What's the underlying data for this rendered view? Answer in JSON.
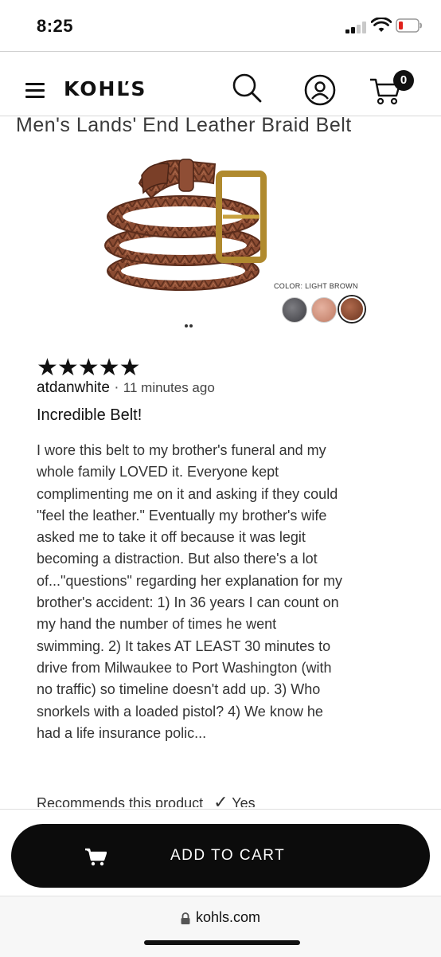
{
  "status": {
    "time": "8:25"
  },
  "header": {
    "logo": "KOHĽS",
    "cart_count": "0",
    "icons": [
      "menu-icon",
      "search-icon",
      "account-icon",
      "cart-icon"
    ]
  },
  "product": {
    "title": "Men's Lands' End Leather Braid Belt",
    "color_label": "COLOR: LIGHT BROWN",
    "swatches": [
      {
        "name": "black",
        "color": "#4a4a4f",
        "selected": false
      },
      {
        "name": "rose",
        "color": "#d49a86",
        "selected": false
      },
      {
        "name": "light-brown",
        "color": "#8b4a33",
        "selected": true
      }
    ]
  },
  "review": {
    "stars": "★★★★★",
    "rating": 5,
    "author": "atdanwhite",
    "separator": "·",
    "time_ago": "11 minutes ago",
    "title": "Incredible Belt!",
    "body": "I wore this belt to my brother's funeral and my whole family LOVED it. Everyone kept complimenting me on it and asking if they could \"feel the leather.\" Eventually my brother's wife asked me to take it off because it was legit becoming a distraction. But also there's a lot of...\"questions\" regarding her explanation for my brother's accident: 1) In 36 years I can count on my hand the number of times he went swimming. 2) It takes AT LEAST 30 minutes to drive from Milwaukee to Port Washington (with no traffic) so timeline doesn't add up. 3) Who snorkels with a loaded pistol? 4) We know he had a life insurance polic...",
    "recommend_label": "Recommends this product",
    "recommend_check": "✓",
    "recommend_value": "Yes"
  },
  "cart_button": {
    "label": "ADD TO CART"
  },
  "browser": {
    "domain": "kohls.com"
  }
}
